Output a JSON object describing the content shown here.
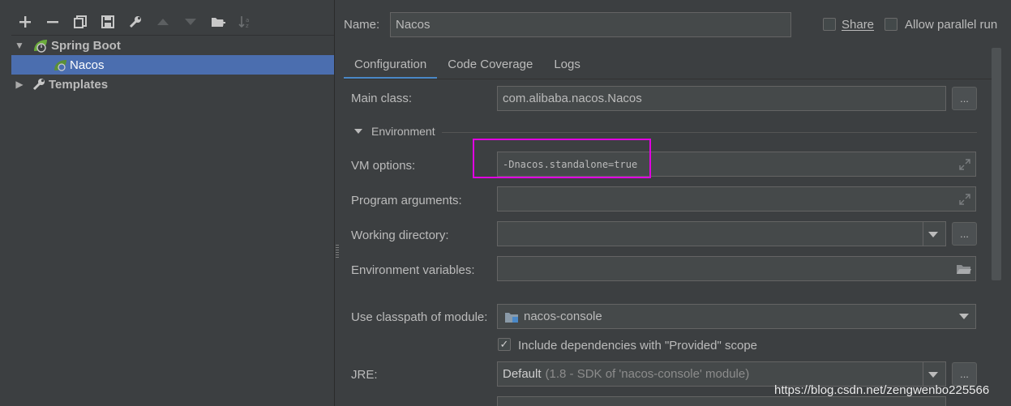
{
  "tree": {
    "root_label": "Spring Boot",
    "child_label": "Nacos",
    "templates_label": "Templates"
  },
  "header": {
    "name_label": "Name:",
    "name_value": "Nacos",
    "share_label": "Share",
    "parallel_label": "Allow parallel run"
  },
  "tabs": [
    {
      "label": "Configuration",
      "active": true
    },
    {
      "label": "Code Coverage",
      "active": false
    },
    {
      "label": "Logs",
      "active": false
    }
  ],
  "form": {
    "main_class_label": "Main class:",
    "main_class_value": "com.alibaba.nacos.Nacos",
    "environment_label": "Environment",
    "vm_options_label": "VM options:",
    "vm_options_value": "-Dnacos.standalone=true",
    "program_args_label": "Program arguments:",
    "working_dir_label": "Working directory:",
    "env_vars_label": "Environment variables:",
    "classpath_label": "Use classpath of module:",
    "classpath_value": "nacos-console",
    "include_deps_label": "Include dependencies with \"Provided\" scope",
    "jre_label": "JRE:",
    "jre_value": "Default",
    "jre_detail": "(1.8 - SDK of 'nacos-console' module)",
    "browse_label": "..."
  },
  "watermark": "https://blog.csdn.net/zengwenbo225566",
  "colors": {
    "background": "#3c3f41",
    "selection": "#4b6eaf",
    "highlight_box": "#e100e1",
    "tab_underline": "#4a88c7"
  }
}
